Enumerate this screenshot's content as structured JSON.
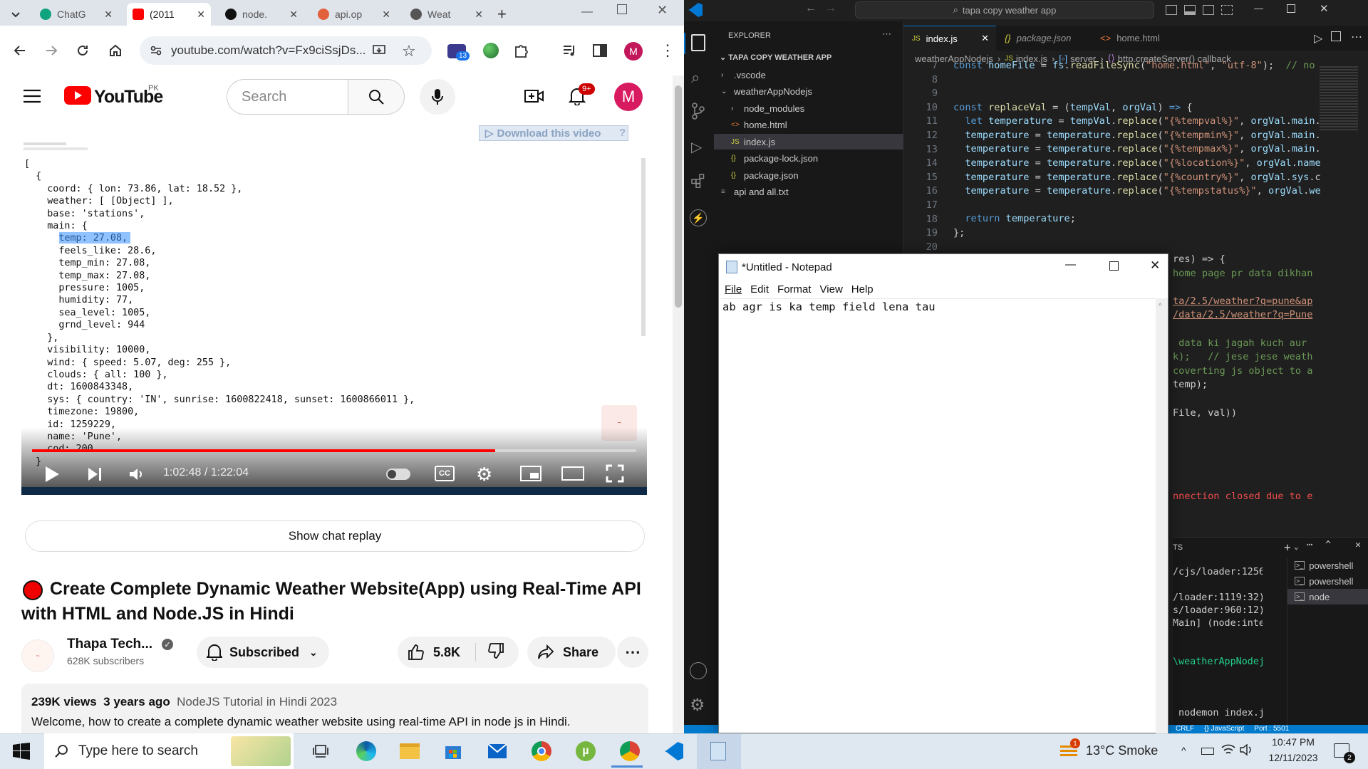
{
  "browser": {
    "tabs": [
      {
        "label": "ChatG",
        "color": "#10a37f"
      },
      {
        "label": "(2011",
        "color": "#ff0000"
      },
      {
        "label": "node.",
        "color": "#111111"
      },
      {
        "label": "api.op",
        "color": "#e2613d"
      },
      {
        "label": "Weat",
        "color": "#555555"
      }
    ],
    "new_tab": "+",
    "url": "youtube.com/watch?v=Fx9ciSsjDs...",
    "extension_badge": "13",
    "profile_initial": "M"
  },
  "youtube": {
    "logo_text": "YouTube",
    "region": "PK",
    "search_placeholder": "Search",
    "notif_badge": "9+",
    "avatar": "M",
    "download_btn": "Download this video",
    "download_help": "?",
    "download_close": "X",
    "video_code_lines": [
      "[",
      "  {",
      "    coord: { lon: 73.86, lat: 18.52 },",
      "    weather: [ [Object] ],",
      "    base: 'stations',",
      "    main: {",
      "      temp: 27.08,",
      "      feels_like: 28.6,",
      "      temp_min: 27.08,",
      "      temp_max: 27.08,",
      "      pressure: 1005,",
      "      humidity: 77,",
      "      sea_level: 1005,",
      "      grnd_level: 944",
      "    },",
      "    visibility: 10000,",
      "    wind: { speed: 5.07, deg: 255 },",
      "    clouds: { all: 100 },",
      "    dt: 1600843348,",
      "    sys: { country: 'IN', sunrise: 1600822418, sunset: 1600866011 },",
      "    timezone: 19800,",
      "    id: 1259229,",
      "    name: 'Pune',",
      "    cod: 200",
      "  }"
    ],
    "time_label": "1:02:48 / 1:22:04",
    "progress_fraction": 0.766,
    "cc_label": "CC",
    "show_chat_replay": "Show chat replay",
    "video_title": "Create Complete Dynamic Weather Website(App) using Real-Time API with HTML and Node.JS in Hindi",
    "channel_name": "Thapa Tech...",
    "subscribers": "628K subscribers",
    "subscribed_label": "Subscribed",
    "likes": "5.8K",
    "share_label": "Share",
    "views": "239K views",
    "age": "3 years ago",
    "tags": "NodeJS Tutorial in Hindi 2023",
    "description": "Welcome, how to create a complete dynamic weather website using real-time API in node js in Hindi."
  },
  "vscode": {
    "search_text": "tapa copy weather app",
    "explorer_label": "EXPLORER",
    "project": "TAPA COPY WEATHER APP",
    "tree": [
      {
        "label": ".vscode",
        "kind": "folder"
      },
      {
        "label": "weatherAppNodejs",
        "kind": "folder-open"
      },
      {
        "label": "node_modules",
        "kind": "folder"
      },
      {
        "label": "home.html",
        "kind": "html"
      },
      {
        "label": "index.js",
        "kind": "js"
      },
      {
        "label": "package-lock.json",
        "kind": "json"
      },
      {
        "label": "package.json",
        "kind": "json"
      },
      {
        "label": "api and all.txt",
        "kind": "txt"
      }
    ],
    "tabs": [
      "index.js",
      "package.json",
      "home.html"
    ],
    "breadcrumb": [
      "weatherAppNodejs",
      "index.js",
      "server",
      "http.createServer() callback"
    ],
    "line_numbers": [
      "7",
      "8",
      "9",
      "10",
      "11",
      "12",
      "13",
      "14",
      "15",
      "16",
      "17",
      "18",
      "19",
      "20"
    ],
    "peek_lines": [
      "res) => {",
      "home page pr data dikhan",
      "",
      "ta/2.5/weather?q=pune&ap",
      "/data/2.5/weather?q=Pune",
      "",
      " data ki jagah kuch aur",
      "k);   // jese jese weath",
      "coverting js object to a",
      "temp);",
      "",
      "File, val))",
      "",
      "",
      "",
      "",
      "",
      "nnection closed due to e"
    ],
    "panel_label": "TS",
    "terminal_lines": [
      "/cjs/loader:1256",
      "",
      "/loader:1119:32)",
      "s/loader:960:12)",
      "Main] (node:inte",
      "",
      "",
      "\\weatherAppNodej",
      "",
      "",
      "",
      " nodemon index.j"
    ],
    "terminals": [
      "powershell",
      "powershell",
      "node"
    ],
    "status_items": [
      "CRLF",
      "{} JavaScript",
      "Port : 5501"
    ]
  },
  "notepad": {
    "title": "*Untitled - Notepad",
    "menu": [
      "File",
      "Edit",
      "Format",
      "View",
      "Help"
    ],
    "content": "ab agr is ka temp field lena tau"
  },
  "taskbar": {
    "search_placeholder": "Type here to search",
    "weather": "13°C  Smoke",
    "time": "10:47 PM",
    "date": "12/11/2023",
    "notif_count": "2"
  }
}
